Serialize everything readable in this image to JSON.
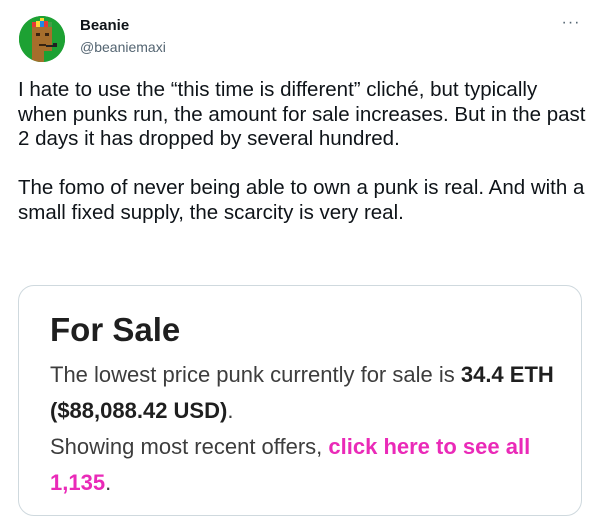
{
  "author": {
    "name": "Beanie",
    "handle": "@beaniemaxi"
  },
  "menu_icon": "more-horizontal-icon",
  "more_label": "···",
  "tweet": {
    "paragraph1": "I hate to use the “this time is different” cliché, but typically when punks run, the amount for sale increases. But in the past 2 days it has dropped by several hundred.",
    "paragraph2": "The fomo of never being able to own a punk is real. And with a small fixed supply, the scarcity is very real."
  },
  "card": {
    "title": "For Sale",
    "line1": "The lowest price punk currently for sale is ",
    "price": "34.4 ETH ($88,088.42 USD)",
    "period1": ".",
    "line2": "Showing most recent offers, ",
    "link": "click here to see all 1,135",
    "period2": "."
  },
  "colors": {
    "link": "#ea2ab8",
    "avatar_bg": "#1da133",
    "handle": "#536471"
  }
}
